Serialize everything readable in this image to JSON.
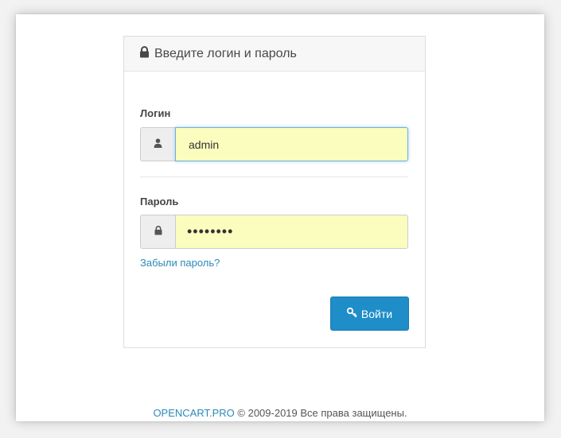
{
  "panel": {
    "heading": "Введите логин и пароль"
  },
  "login": {
    "label": "Логин",
    "value": "admin"
  },
  "password": {
    "label": "Пароль",
    "value": "••••••••"
  },
  "forgot_link": "Забыли пароль?",
  "submit_label": "Войти",
  "footer": {
    "brand_link": "OPENCART.PRO",
    "copyright": "© 2009-2019 Все права защищены."
  },
  "colors": {
    "accent": "#1f8dc8",
    "link": "#2a8ab8",
    "autofill": "#fbfdbe"
  },
  "icons": {
    "heading": "lock-icon",
    "login": "user-icon",
    "password": "lock-icon",
    "submit": "key-icon"
  }
}
